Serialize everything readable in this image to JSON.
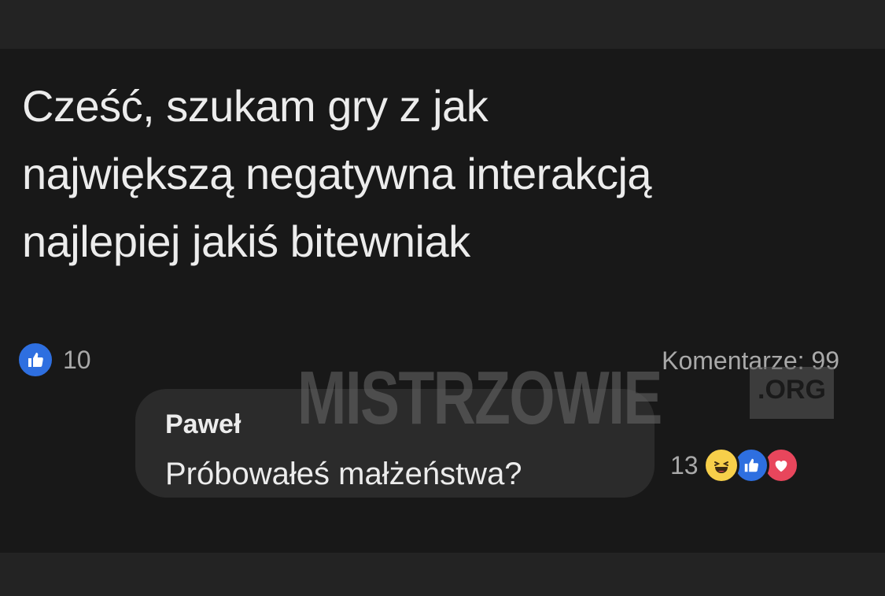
{
  "post": {
    "text_lines": [
      "Cześć, szukam gry z jak",
      "największą negatywna interakcją",
      "najlepiej jakiś bitewniak"
    ],
    "like_count": "10",
    "comments_label": "Komentarze: 99"
  },
  "watermark": {
    "main": "MISTRZOWIE",
    "suffix": ".ORG"
  },
  "comment": {
    "author": "Paweł",
    "text": "Próbowałeś małżeństwa?",
    "reaction_count": "13",
    "reactions": [
      "haha-icon",
      "like-icon",
      "love-icon"
    ]
  },
  "colors": {
    "like_blue": "#2e6fe0",
    "haha_yellow": "#f7cf4a",
    "love_red": "#e8465c"
  }
}
